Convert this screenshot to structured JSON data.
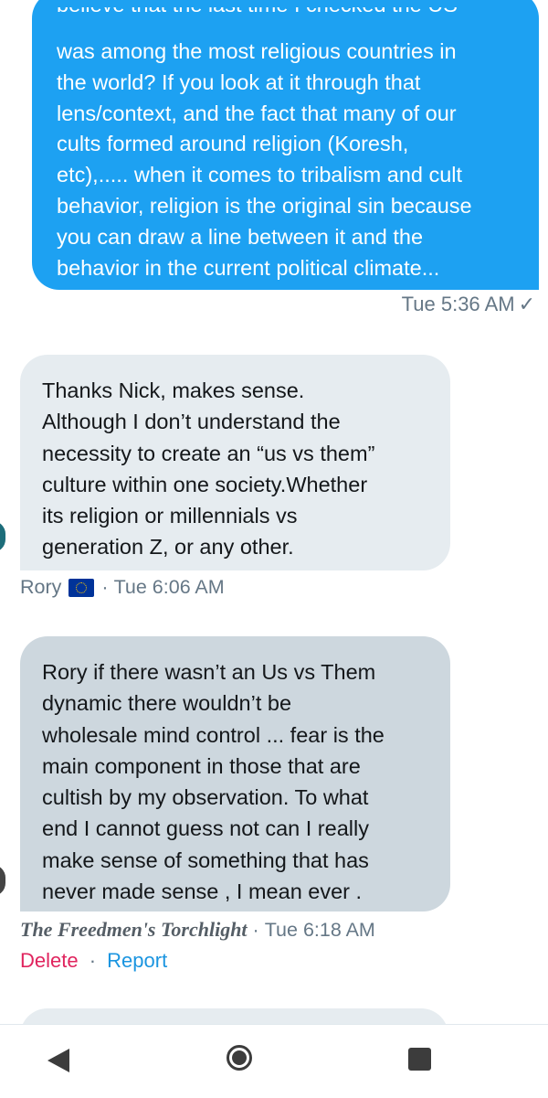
{
  "sent_message": {
    "cut_line": "believe that the last time I checked the US",
    "lines": [
      "was among the most religious countries in",
      "the world?  If you look at it through that",
      "lens/context, and the fact that many of our",
      "cults formed around religion (Koresh,",
      "etc),..... when it comes to tribalism and cult",
      "behavior, religion is the original sin because",
      "you can draw a line between it and the",
      "behavior in the current political climate..."
    ],
    "timestamp": "Tue 5:36 AM",
    "status_glyph": "✓",
    "bubble_color": "#1da1f2"
  },
  "messages": [
    {
      "lines": [
        "Thanks Nick, makes sense.",
        "Although I don’t understand the",
        "necessity to create an “us vs them”",
        "culture within one society.Whether",
        "its religion or millennials vs",
        "generation Z, or any other."
      ],
      "sender": "Rory",
      "flag_icon": "eu-flag-icon",
      "separator": "·",
      "timestamp": "Tue 6:06 AM",
      "bubble_color": "#e6ecf0"
    },
    {
      "lines": [
        "Rory if there wasn’t an Us vs Them",
        "dynamic there wouldn’t be",
        "wholesale mind control ... fear is the",
        "main component in those that are",
        "cultish by my observation. To what",
        "end I cannot guess not can I really",
        "make sense of something that has",
        "never made sense , I mean ever ."
      ],
      "sender": "The Freedmen's Torchlight",
      "separator": "·",
      "timestamp": "Tue 6:18 AM",
      "bubble_color": "#cdd7de",
      "actions": {
        "delete": "Delete",
        "separator": "·",
        "report": "Report",
        "delete_color": "#e0245e",
        "report_color": "#1b95e0"
      }
    }
  ],
  "navbar": {
    "back_icon": "back-triangle-icon",
    "home_icon": "home-circle-icon",
    "recent_icon": "recent-apps-square-icon"
  }
}
